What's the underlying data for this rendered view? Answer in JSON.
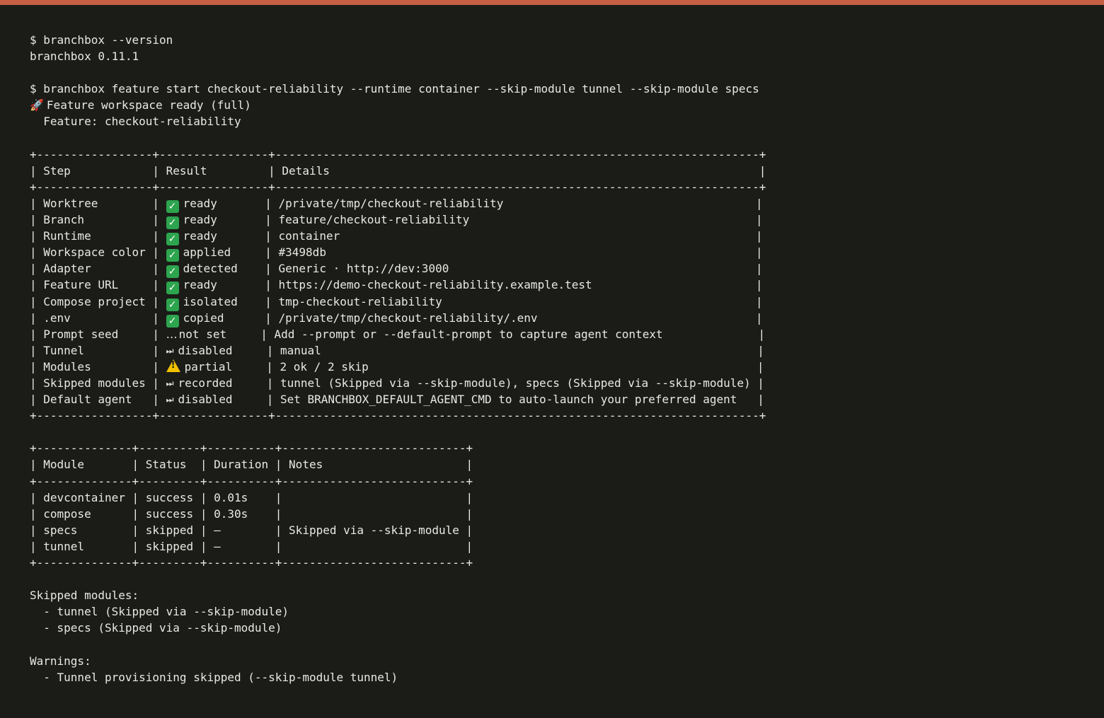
{
  "cmd1": {
    "prompt": "$ branchbox --version",
    "output": "branchbox 0.11.1"
  },
  "cmd2": {
    "prompt": "$ branchbox feature start checkout-reliability --runtime container --skip-module tunnel --skip-module specs",
    "status_icon": "rocket-icon",
    "status": "Feature workspace ready (full)",
    "feature_line": "  Feature: checkout-reliability"
  },
  "steps_table": {
    "border": "+-----------------+----------------+-----------------------------------------------------------------------+",
    "header": "| Step            | Result         | Details                                                               |",
    "rows": [
      {
        "pre": "| Worktree        | ",
        "icon": "check",
        "result": "ready       ",
        "post": "| /private/tmp/checkout-reliability                                     |"
      },
      {
        "pre": "| Branch          | ",
        "icon": "check",
        "result": "ready       ",
        "post": "| feature/checkout-reliability                                          |"
      },
      {
        "pre": "| Runtime         | ",
        "icon": "check",
        "result": "ready       ",
        "post": "| container                                                             |"
      },
      {
        "pre": "| Workspace color | ",
        "icon": "check",
        "result": "applied     ",
        "post": "| #3498db                                                               |"
      },
      {
        "pre": "| Adapter         | ",
        "icon": "check",
        "result": "detected    ",
        "post": "| Generic · http://dev:3000                                             |"
      },
      {
        "pre": "| Feature URL     | ",
        "icon": "check",
        "result": "ready       ",
        "post": "| https://demo-checkout-reliability.example.test                        |"
      },
      {
        "pre": "| Compose project | ",
        "icon": "check",
        "result": "isolated    ",
        "post": "| tmp-checkout-reliability                                              |"
      },
      {
        "pre": "| .env            | ",
        "icon": "check",
        "result": "copied      ",
        "post": "| /private/tmp/checkout-reliability/.env                                |"
      },
      {
        "pre": "| Prompt seed     | ",
        "icon": "ellipsis",
        "result": "not set     ",
        "post": "| Add --prompt or --default-prompt to capture agent context              |"
      },
      {
        "pre": "| Tunnel          | ",
        "icon": "skip",
        "result": "disabled     ",
        "post": "| manual                                                                |"
      },
      {
        "pre": "| Modules         | ",
        "icon": "warn",
        "result": "partial     ",
        "post": "| 2 ok / 2 skip                                                         |"
      },
      {
        "pre": "| Skipped modules | ",
        "icon": "skip",
        "result": "recorded     ",
        "post": "| tunnel (Skipped via --skip-module), specs (Skipped via --skip-module) |"
      },
      {
        "pre": "| Default agent   | ",
        "icon": "skip",
        "result": "disabled     ",
        "post": "| Set BRANCHBOX_DEFAULT_AGENT_CMD to auto-launch your preferred agent   |"
      }
    ]
  },
  "modules_table": {
    "border": "+--------------+---------+----------+---------------------------+",
    "header": "| Module       | Status  | Duration | Notes                     |",
    "rows": [
      "| devcontainer | success | 0.01s    |                           |",
      "| compose      | success | 0.30s    |                           |",
      "| specs        | skipped | –        | Skipped via --skip-module |",
      "| tunnel       | skipped | –        |                           |"
    ]
  },
  "skipped": {
    "title": "Skipped modules:",
    "items": [
      "  - tunnel (Skipped via --skip-module)",
      "  - specs (Skipped via --skip-module)"
    ]
  },
  "warnings": {
    "title": "Warnings:",
    "items": [
      "  - Tunnel provisioning skipped (--skip-module tunnel)"
    ]
  },
  "colors": {
    "accent": "#c65f43",
    "background": "#1b1c18",
    "text": "#e9e9e4"
  }
}
